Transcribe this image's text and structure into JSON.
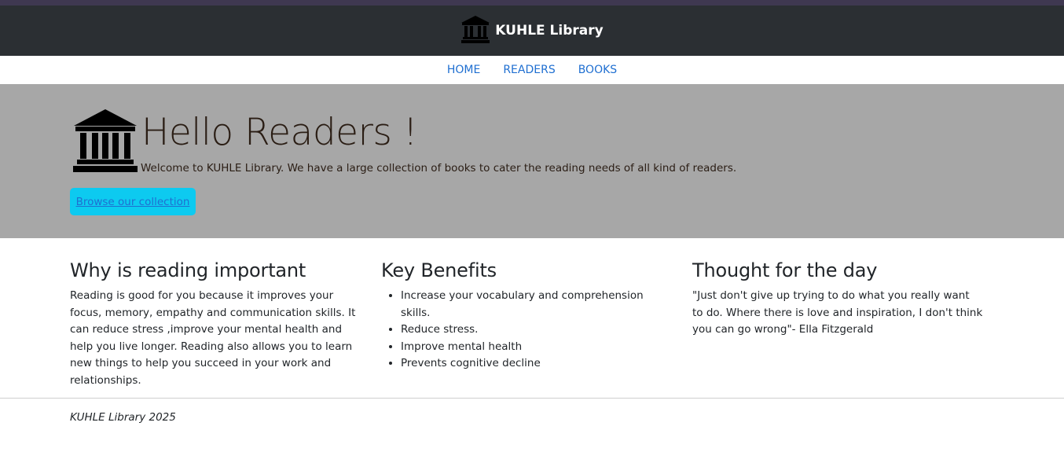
{
  "navbar": {
    "brand_icon": "bank-building-icon",
    "brand": "KUHLE Library",
    "bg": "#2b2f33"
  },
  "menu": {
    "items": [
      "HOME",
      "READERS",
      "BOOKS"
    ],
    "link_color": "#1f6fd1"
  },
  "hero": {
    "icon": "bank-building-icon",
    "title": "Hello Readers !",
    "lead": "Welcome to KUHLE Library. We have a large collection of books to cater the reading needs of all kind of readers.",
    "button": "Browse our collection",
    "bg": "#a7a7a7",
    "button_color": "#0dcaf0"
  },
  "sections": {
    "why": {
      "heading": "Why is reading important",
      "text": "Reading is good for you because it improves your focus, memory, empathy and communication skills. It can reduce stress ,improve your mental health and help you live longer. Reading also allows you to learn new things to help you succeed in your work and relationships."
    },
    "benefits": {
      "heading": "Key Benefits",
      "items": [
        "Increase your vocabulary and comprehension skills.",
        "Reduce stress.",
        "Improve mental health",
        "Prevents cognitive decline"
      ]
    },
    "thought": {
      "heading": "Thought for the day",
      "text": "\"Just don't give up trying to do what you really want to do. Where there is love and inspiration, I don't think you can go wrong\"- Ella Fitzgerald"
    }
  },
  "footer": {
    "text": "KUHLE Library 2025"
  }
}
